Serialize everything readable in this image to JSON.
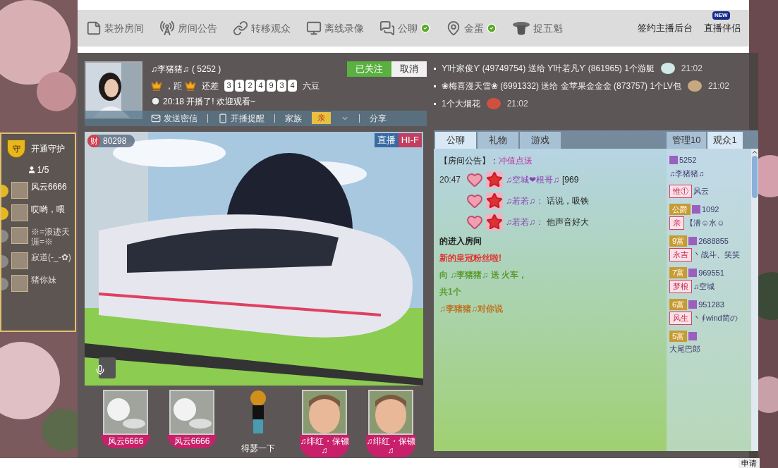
{
  "toolbar": {
    "items": [
      {
        "label": "装扮房间",
        "checked": false
      },
      {
        "label": "房间公告",
        "checked": false
      },
      {
        "label": "转移观众",
        "checked": false
      },
      {
        "label": "离线录像",
        "checked": false
      },
      {
        "label": "公聊",
        "checked": true
      },
      {
        "label": "金蛋",
        "checked": true
      },
      {
        "label": "捉五魁",
        "checked": false
      }
    ],
    "links": [
      {
        "label": "签约主播后台"
      },
      {
        "label": "直播伴侣",
        "badge": "NEW"
      }
    ]
  },
  "streamer": {
    "name": "♫李猪猪♫",
    "id": "( 5252 )",
    "distance": "，距",
    "gap_label": "还差",
    "digits": [
      "3",
      "1",
      "2",
      "4",
      "9",
      "3",
      "4"
    ],
    "unit": "六豆",
    "start": "20:18 开播了! 欢迎观看~",
    "buttons": [
      "已关注",
      "取消"
    ]
  },
  "actions": [
    {
      "label": "发送密信"
    },
    {
      "label": "开播提醒"
    },
    {
      "label": "家族",
      "badge": "亲"
    },
    {
      "label": "分享"
    }
  ],
  "video": {
    "wealth_icon": "财",
    "wealth": "80298",
    "tags": [
      "直播",
      "HI-F"
    ]
  },
  "guard": {
    "badge": "守",
    "title": "开通守护",
    "count": "1/5",
    "members": [
      {
        "name": "风云6666",
        "active": true
      },
      {
        "name": "哎哟，喂",
        "active": true
      },
      {
        "name": "※=浪迹天涯=※",
        "active": false
      },
      {
        "name": "寂道(-_-✿)",
        "active": false
      },
      {
        "name": "猪你妹",
        "active": false
      }
    ]
  },
  "seats": [
    {
      "name": "风云6666",
      "kind": "avatar"
    },
    {
      "name": "风云6666",
      "kind": "avatar"
    },
    {
      "name": "得瑟一下",
      "kind": "figure"
    },
    {
      "name": "♫绯红・保镖♫",
      "kind": "avatar"
    },
    {
      "name": "♫绯红・保镖♫",
      "kind": "avatar"
    }
  ],
  "gifts": [
    {
      "text": "ϒ叶家俊ϒ (49749754) 送给 ϒ叶若凡ϒ (861965) 1个游艇",
      "time": "21:02"
    },
    {
      "text": "❀梅喜漫天雪❀ (6991332) 送给 金苹果金金金 (873757) 1个LV包",
      "time": "21:02"
    },
    {
      "text": "1个大烟花",
      "time": "21:02"
    }
  ],
  "chat_tabs": [
    {
      "label": "公聊",
      "selected": true
    },
    {
      "label": "礼物",
      "selected": false
    },
    {
      "label": "游戏",
      "selected": false
    }
  ],
  "user_tabs": [
    {
      "label": "管理10",
      "selected": false
    },
    {
      "label": "观众1",
      "selected": true
    }
  ],
  "notice": {
    "label": "【房间公告】：",
    "text": "冲值点送"
  },
  "messages": [
    {
      "kind": "chat",
      "time": "20:47",
      "user": "♫空城❤根哥♫",
      "text": "[969"
    },
    {
      "kind": "chat",
      "user": "♫若若♫：",
      "text": "话说，吸铁"
    },
    {
      "kind": "chat",
      "user": "♫若若♫：",
      "text": "他声音好大"
    },
    {
      "kind": "system",
      "text": "的进入房间",
      "color": "#222222"
    },
    {
      "kind": "system",
      "text": "新的皇冠粉丝啦!",
      "color": "#e03030"
    },
    {
      "kind": "system",
      "text": "向 ♫李猪猪♫ 送 火车，",
      "color": "#5a9a2a"
    },
    {
      "kind": "system",
      "text": "共1个",
      "color": "#5a9a2a"
    },
    {
      "kind": "system",
      "text": "♫李猪猪♫对你说",
      "color": "#c07020"
    }
  ],
  "users": [
    {
      "id": "5252",
      "name": "♫李猪猪♫"
    },
    {
      "tag": "惟①",
      "name": "风云"
    },
    {
      "rank": "公爵",
      "id": "1092",
      "tag": "亲",
      "name": "【潜☺水☺"
    },
    {
      "rank": "9富",
      "id": "2688855",
      "tag": "永吉",
      "name": "丶战斗、笑笑"
    },
    {
      "rank": "7富",
      "id": "969551",
      "tag": "梦桹",
      "name": "♫空城"
    },
    {
      "rank": "6富",
      "id": "951283",
      "tag": "风生",
      "name": "丶∮wind简の"
    },
    {
      "rank": "5富",
      "name": "大尾巴郎"
    }
  ],
  "apply": "申请"
}
